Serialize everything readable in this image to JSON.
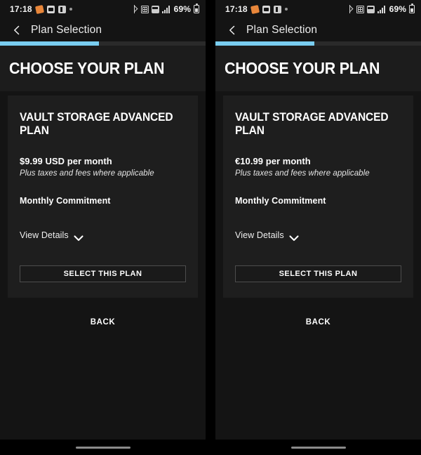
{
  "screens": [
    {
      "status_bar": {
        "time": "17:18",
        "battery_percent": "69%",
        "left_icons": [
          "heart-app-icon",
          "photo-app-icon",
          "music-app-icon",
          "notification-dot-icon"
        ],
        "right_icons": [
          "bluetooth-icon",
          "qr-icon",
          "badge-icon",
          "signal-icon",
          "battery-icon"
        ]
      },
      "app_bar": {
        "back_icon": "chevron-left-icon",
        "title": "Plan Selection"
      },
      "progress": {
        "percent": 48
      },
      "headline": "CHOOSE YOUR PLAN",
      "card": {
        "plan_title": "VAULT STORAGE ADVANCED PLAN",
        "price": "$9.99 USD per month",
        "taxes_note": "Plus taxes and fees where applicable",
        "commitment": "Monthly Commitment",
        "view_details_label": "View Details",
        "view_details_icon": "chevron-down-icon",
        "select_label": "SELECT THIS PLAN"
      },
      "back_label": "BACK"
    },
    {
      "status_bar": {
        "time": "17:18",
        "battery_percent": "69%",
        "left_icons": [
          "heart-app-icon",
          "photo-app-icon",
          "music-app-icon",
          "notification-dot-icon"
        ],
        "right_icons": [
          "bluetooth-icon",
          "qr-icon",
          "badge-icon",
          "signal-icon",
          "battery-icon"
        ]
      },
      "app_bar": {
        "back_icon": "chevron-left-icon",
        "title": "Plan Selection"
      },
      "progress": {
        "percent": 48
      },
      "headline": "CHOOSE YOUR PLAN",
      "card": {
        "plan_title": "VAULT STORAGE ADVANCED PLAN",
        "price": "€10.99 per month",
        "taxes_note": "Plus taxes and fees where applicable",
        "commitment": "Monthly Commitment",
        "view_details_label": "View Details",
        "view_details_icon": "chevron-down-icon",
        "select_label": "SELECT THIS PLAN"
      },
      "back_label": "BACK"
    }
  ],
  "colors": {
    "page_background": "#141414",
    "card_background": "#1e1e1e",
    "headline_band": "#1c1c1c",
    "progress_fill": "#79cdf0",
    "progress_track": "#2a2a2a",
    "button_border": "#4d4d4d",
    "text_primary": "#ffffff",
    "gesture_pill": "#8a8a8a"
  }
}
